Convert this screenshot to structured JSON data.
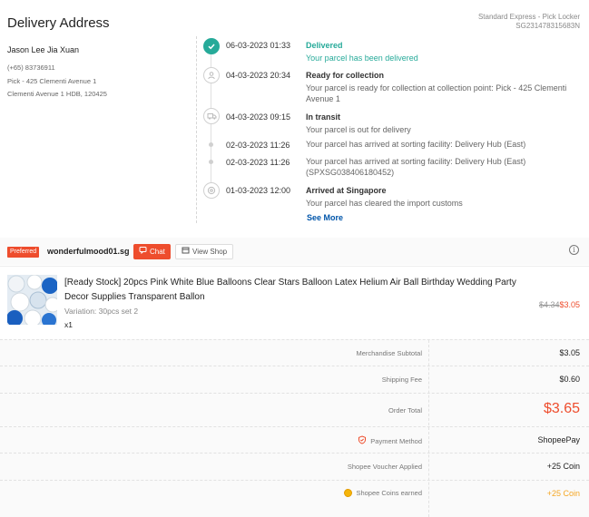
{
  "delivery": {
    "title": "Delivery Address",
    "service": "Standard Express - Pick Locker",
    "tracking": "SG231478315683N",
    "recipient": {
      "name": "Jason Lee Jia Xuan",
      "phone": "(+65) 83736911",
      "address_line1": "Pick - 425 Clementi Avenue 1",
      "address_line2": "Clementi Avenue 1 HDB, 120425"
    },
    "timeline": [
      {
        "time": "06-03-2023 01:33",
        "status": "Delivered",
        "desc": "Your parcel has been delivered",
        "icon": "check-icon"
      },
      {
        "time": "04-03-2023 20:34",
        "status": "Ready for collection",
        "desc": "Your parcel is ready for collection at collection point: Pick - 425 Clementi Avenue 1",
        "icon": "person-icon"
      },
      {
        "time": "04-03-2023 09:15",
        "status": "In transit",
        "desc": "Your parcel is out for delivery",
        "icon": "truck-icon"
      },
      {
        "time": "02-03-2023 11:26",
        "status": "",
        "desc": "Your parcel has arrived at sorting facility: Delivery Hub (East)",
        "icon": "dot"
      },
      {
        "time": "02-03-2023 11:26",
        "status": "",
        "desc": "Your parcel has arrived at sorting facility: Delivery Hub (East) (SPXSG038406180452)",
        "icon": "dot"
      },
      {
        "time": "01-03-2023 12:00",
        "status": "Arrived at Singapore",
        "desc": "Your parcel has cleared the import customs",
        "icon": "globe-icon"
      }
    ],
    "see_more": "See More"
  },
  "shop": {
    "badge": "Preferred",
    "name": "wonderfulmood01.sg",
    "chat_label": "Chat",
    "view_shop_label": "View Shop"
  },
  "product": {
    "title": "[Ready Stock] 20pcs Pink White Blue Balloons Clear Stars Balloon Latex Helium Air Ball Birthday Wedding Party Decor Supplies Transparent Ballon",
    "variation": "Variation: 30pcs set 2",
    "qty": "x1",
    "original_price": "$4.34",
    "price": "$3.05"
  },
  "summary": {
    "merchandise_subtotal_label": "Merchandise Subtotal",
    "merchandise_subtotal": "$3.05",
    "shipping_fee_label": "Shipping Fee",
    "shipping_fee": "$0.60",
    "order_total_label": "Order Total",
    "order_total": "$3.65",
    "payment_method_label": "Payment Method",
    "payment_method": "ShopeePay",
    "voucher_label": "Shopee Voucher Applied",
    "voucher_value": "+25 Coin",
    "coins_label": "Shopee Coins earned",
    "coins_value": "+25 Coin"
  },
  "colors": {
    "accent": "#ee4d2d",
    "delivered": "#26aa99",
    "link": "#0055aa",
    "coin": "#f5a623"
  }
}
